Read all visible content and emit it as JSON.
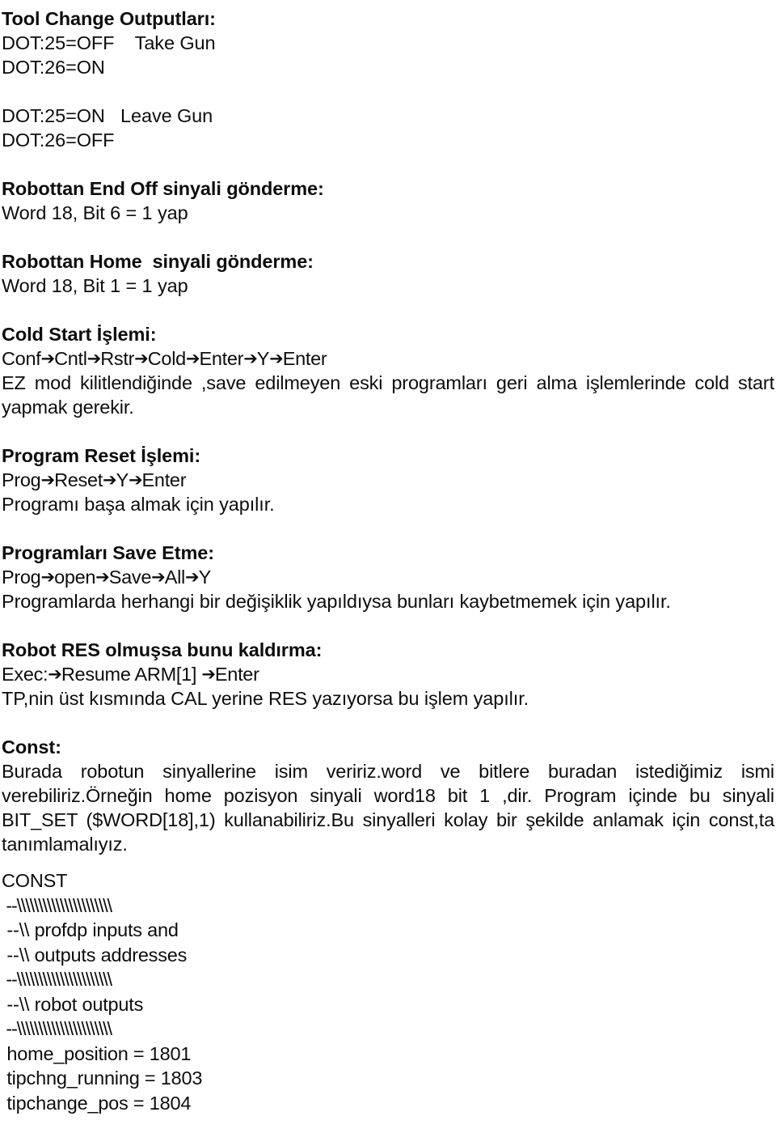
{
  "document": {
    "title": "Tool Change Outputları:",
    "language": "tr",
    "background_color": "#ffffff",
    "text_color": "#0d0d0d"
  },
  "sections": {
    "tool_change": {
      "heading": "Tool Change Outputları:",
      "take_gun_line1": "DOT:25=OFF    Take Gun",
      "take_gun_line2": "DOT:26=ON",
      "leave_gun_line1": "DOT:25=ON   Leave Gun",
      "leave_gun_line2": "DOT:26=OFF"
    },
    "end_off": {
      "heading": "Robottan End Off sinyali gönderme:",
      "body": "Word 18, Bit 6 = 1 yap"
    },
    "home_signal": {
      "heading": "Robottan Home  sinyali gönderme:",
      "body": "Word 18, Bit 1 = 1 yap"
    },
    "cold_start": {
      "heading": "Cold Start İşlemi:",
      "steps": [
        "Conf",
        "Cntl",
        "Rstr",
        "Cold",
        "Enter",
        "Y",
        "Enter"
      ],
      "arrow": "➔",
      "body": "EZ mod kilitlendiğinde ,save edilmeyen eski programları geri alma işlemlerinde cold start yapmak gerekir."
    },
    "program_reset": {
      "heading": "Program Reset İşlemi:",
      "steps": [
        "Prog",
        "Reset",
        "Y",
        "Enter"
      ],
      "arrow": "➔",
      "body": "Programı başa almak için yapılır."
    },
    "program_save": {
      "heading": "Programları Save Etme:",
      "steps": [
        "Prog",
        "open",
        "Save",
        "All",
        "Y"
      ],
      "arrow": "➔",
      "body": "Programlarda herhangi bir değişiklik yapıldıysa bunları kaybetmemek için yapılır."
    },
    "robot_res": {
      "heading": "Robot RES olmuşsa bunu kaldırma:",
      "steps": [
        "Exec:",
        "Resume ARM[1] ",
        "Enter"
      ],
      "arrow": "➔",
      "body": "TP,nin üst kısmında CAL yerine RES yazıyorsa bu işlem yapılır."
    },
    "const": {
      "heading": "Const:",
      "body": "Burada robotun sinyallerine isim veririz.word ve bitlere buradan istediğimiz ismi verebiliriz.Örneğin home pozisyon sinyali word18 bit 1 ,dir. Program içinde bu sinyali BIT_SET ($WORD[18],1) kullanabiliriz.Bu sinyalleri kolay bir şekilde anlamak için const,ta tanımlamalıyız."
    },
    "const_code": {
      "keyword": "CONST",
      "lines": [
        " --\\\\\\\\\\\\\\\\\\\\\\\\\\\\\\\\\\\\\\\\\\\\",
        " --\\\\ profdp inputs and",
        " --\\\\ outputs addresses",
        " --\\\\\\\\\\\\\\\\\\\\\\\\\\\\\\\\\\\\\\\\\\\\",
        " --\\\\ robot outputs",
        " --\\\\\\\\\\\\\\\\\\\\\\\\\\\\\\\\\\\\\\\\\\\\",
        " home_position = 1801",
        " tipchng_running = 1803",
        " tipchange_pos = 1804"
      ]
    }
  }
}
